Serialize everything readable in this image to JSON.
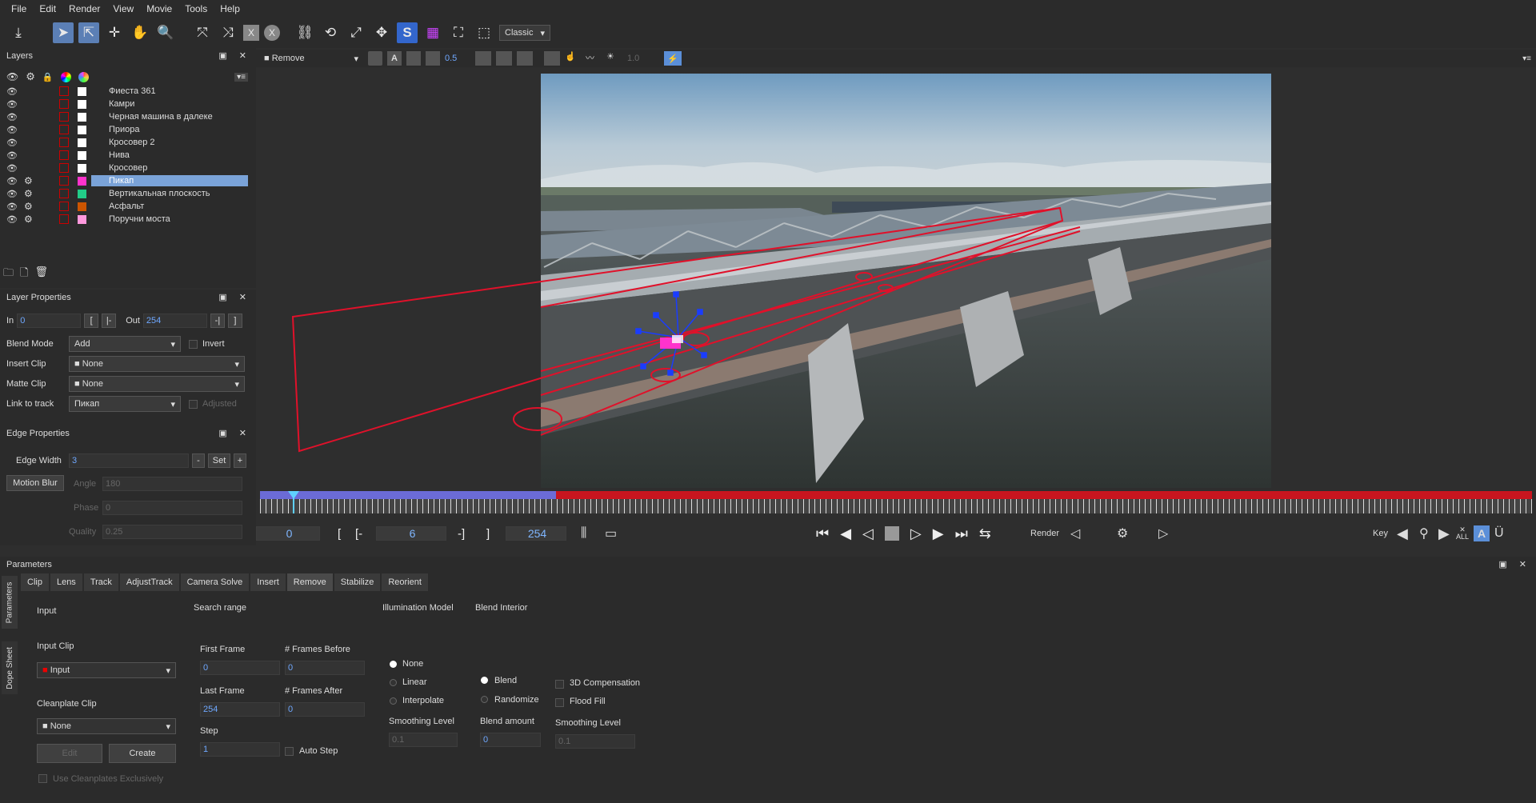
{
  "menu": [
    "File",
    "Edit",
    "Render",
    "View",
    "Movie",
    "Tools",
    "Help"
  ],
  "toolbar": {
    "mode": "Classic"
  },
  "viewer_toolbar": {
    "module": "Remove",
    "opacity": "0.5",
    "gain": "1.0"
  },
  "layers": {
    "title": "Layers",
    "items": [
      {
        "name": "Фиеста 361",
        "color": "#ffffff",
        "gear": false,
        "selected": false
      },
      {
        "name": "Камри",
        "color": "#ffffff",
        "gear": false,
        "selected": false
      },
      {
        "name": "Черная машина в далеке",
        "color": "#ffffff",
        "gear": false,
        "selected": false
      },
      {
        "name": "Приора",
        "color": "#ffffff",
        "gear": false,
        "selected": false
      },
      {
        "name": "Кросовер 2",
        "color": "#ffffff",
        "gear": false,
        "selected": false
      },
      {
        "name": "Нива",
        "color": "#ffffff",
        "gear": false,
        "selected": false
      },
      {
        "name": "Кросовер",
        "color": "#ffffff",
        "gear": false,
        "selected": false
      },
      {
        "name": "Пикап",
        "color": "#ff33cc",
        "gear": true,
        "selected": true
      },
      {
        "name": "Вертикальная плоскость",
        "color": "#22cc88",
        "gear": true,
        "selected": false
      },
      {
        "name": "Асфальт",
        "color": "#cc5500",
        "gear": true,
        "selected": false
      },
      {
        "name": "Поручни моста",
        "color": "#ff99dd",
        "gear": true,
        "selected": false
      }
    ]
  },
  "layer_props": {
    "title": "Layer Properties",
    "in_label": "In",
    "in_value": "0",
    "out_label": "Out",
    "out_value": "254",
    "blend_label": "Blend Mode",
    "blend_value": "Add",
    "invert_label": "Invert",
    "insert_label": "Insert Clip",
    "insert_value": "None",
    "matte_label": "Matte Clip",
    "matte_value": "None",
    "link_label": "Link to track",
    "link_value": "Пикап",
    "adjusted_label": "Adjusted"
  },
  "edge_props": {
    "title": "Edge Properties",
    "width_label": "Edge Width",
    "width_value": "3",
    "set_label": "Set",
    "motion_blur": "Motion Blur",
    "angle_label": "Angle",
    "angle_value": "180",
    "phase_label": "Phase",
    "phase_value": "0",
    "quality_label": "Quality",
    "quality_value": "0.25"
  },
  "timeline": {
    "start": "0",
    "current": "6",
    "end": "254",
    "render_label": "Render",
    "key_label": "Key",
    "all_label": "ALL"
  },
  "params": {
    "title": "Parameters",
    "side_tabs": [
      "Parameters",
      "Dope Sheet"
    ],
    "tabs": [
      "Clip",
      "Lens",
      "Track",
      "AdjustTrack",
      "Camera Solve",
      "Insert",
      "Remove",
      "Stabilize",
      "Reorient"
    ],
    "active_tab": "Remove",
    "input_group": "Input",
    "search_group": "Search range",
    "illum_group": "Illumination Model",
    "blend_group": "Blend Interior",
    "input_clip_label": "Input Clip",
    "input_clip_value": "Input",
    "cleanplate_label": "Cleanplate Clip",
    "cleanplate_value": "None",
    "edit_label": "Edit",
    "create_label": "Create",
    "use_clean_label": "Use Cleanplates Exclusively",
    "first_frame_label": "First Frame",
    "first_frame_value": "0",
    "frames_before_label": "# Frames Before",
    "frames_before_value": "0",
    "last_frame_label": "Last Frame",
    "last_frame_value": "254",
    "frames_after_label": "# Frames After",
    "frames_after_value": "0",
    "step_label": "Step",
    "step_value": "1",
    "auto_step_label": "Auto Step",
    "illum_none": "None",
    "illum_linear": "Linear",
    "illum_interp": "Interpolate",
    "illum_smooth_label": "Smoothing Level",
    "illum_smooth_value": "0.1",
    "blend_blend": "Blend",
    "blend_random": "Randomize",
    "blend_amount_label": "Blend amount",
    "blend_amount_value": "0",
    "comp3d_label": "3D Compensation",
    "flood_label": "Flood Fill",
    "smooth2_label": "Smoothing Level",
    "smooth2_value": "0.1"
  }
}
